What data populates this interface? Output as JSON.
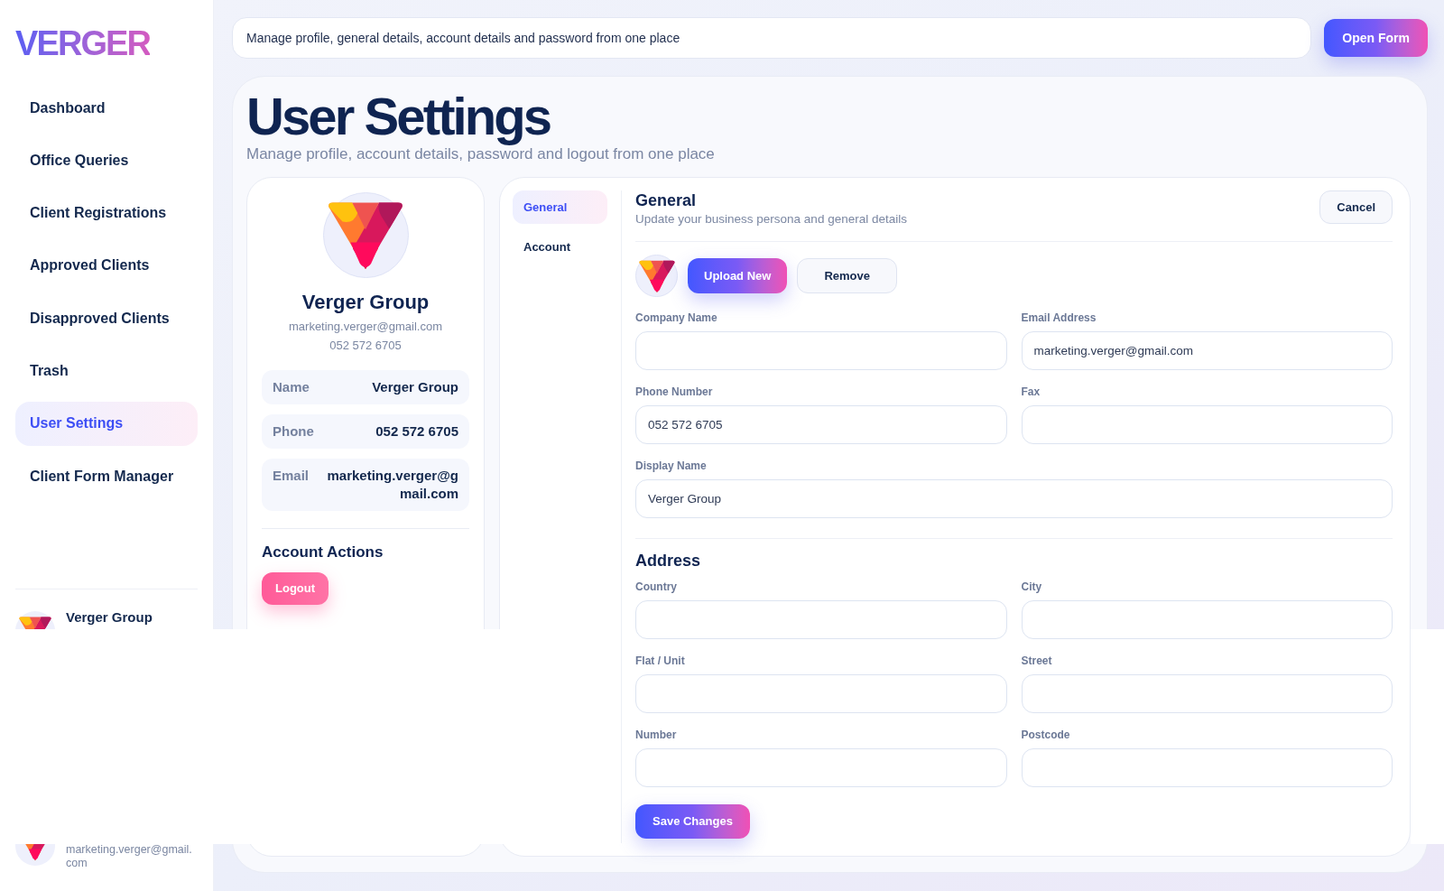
{
  "sidebar": {
    "logo": "VERGER",
    "items": [
      {
        "label": "Dashboard",
        "selected": false
      },
      {
        "label": "Office Queries",
        "selected": false
      },
      {
        "label": "Client Registrations",
        "selected": false
      },
      {
        "label": "Approved Clients",
        "selected": false
      },
      {
        "label": "Disapproved Clients",
        "selected": false
      },
      {
        "label": "Trash",
        "selected": false
      },
      {
        "label": "User Settings",
        "selected": true
      },
      {
        "label": "Client Form Manager",
        "selected": false
      }
    ],
    "account": {
      "name": "Verger Group",
      "email": "marketing.verger@gmail.com"
    }
  },
  "header": {
    "text": "Manage profile, general details, account details and password from one place",
    "button": "Open Form"
  },
  "page": {
    "title": "User Settings",
    "subtitle": "Manage profile, account details, password and logout from one place"
  },
  "profile_card": {
    "name": "Verger Group",
    "email": "marketing.verger@gmail.com",
    "phone": "052 572 6705",
    "details": [
      {
        "label": "Name",
        "value": "Verger Group"
      },
      {
        "label": "Phone",
        "value": "052 572 6705"
      },
      {
        "label": "Email",
        "value": "marketing.verger@gmail.com"
      }
    ],
    "actions_title": "Account Actions",
    "logout_button": "Logout"
  },
  "settings": {
    "tabs": [
      {
        "label": "General",
        "selected": true
      },
      {
        "label": "Account",
        "selected": false
      }
    ],
    "section": {
      "title": "General",
      "subtitle": "Update your business persona and general details"
    },
    "cancel_button": "Cancel",
    "upload_button": "Upload New",
    "remove_button": "Remove",
    "field_rows": [
      {
        "fields": [
          {
            "label": "Company Name"
          },
          {
            "label": "Email Address",
            "value": "marketing.verger@gmail.com"
          }
        ]
      },
      {
        "fields": [
          {
            "label": "Phone Number",
            "value": "052 572 6705"
          },
          {
            "label": "Fax"
          }
        ]
      },
      {
        "fields": [
          {
            "label": "Display Name",
            "value": "Verger Group"
          }
        ]
      }
    ],
    "address": {
      "title": "Address",
      "field_rows": [
        {
          "fields": [
            {
              "label": "Country"
            },
            {
              "label": "City"
            }
          ]
        },
        {
          "fields": [
            {
              "label": "Flat / Unit"
            },
            {
              "label": "Street"
            }
          ]
        },
        {
          "fields": [
            {
              "label": "Number"
            },
            {
              "label": "Postcode"
            }
          ]
        }
      ]
    },
    "save_button": "Save Changes"
  }
}
